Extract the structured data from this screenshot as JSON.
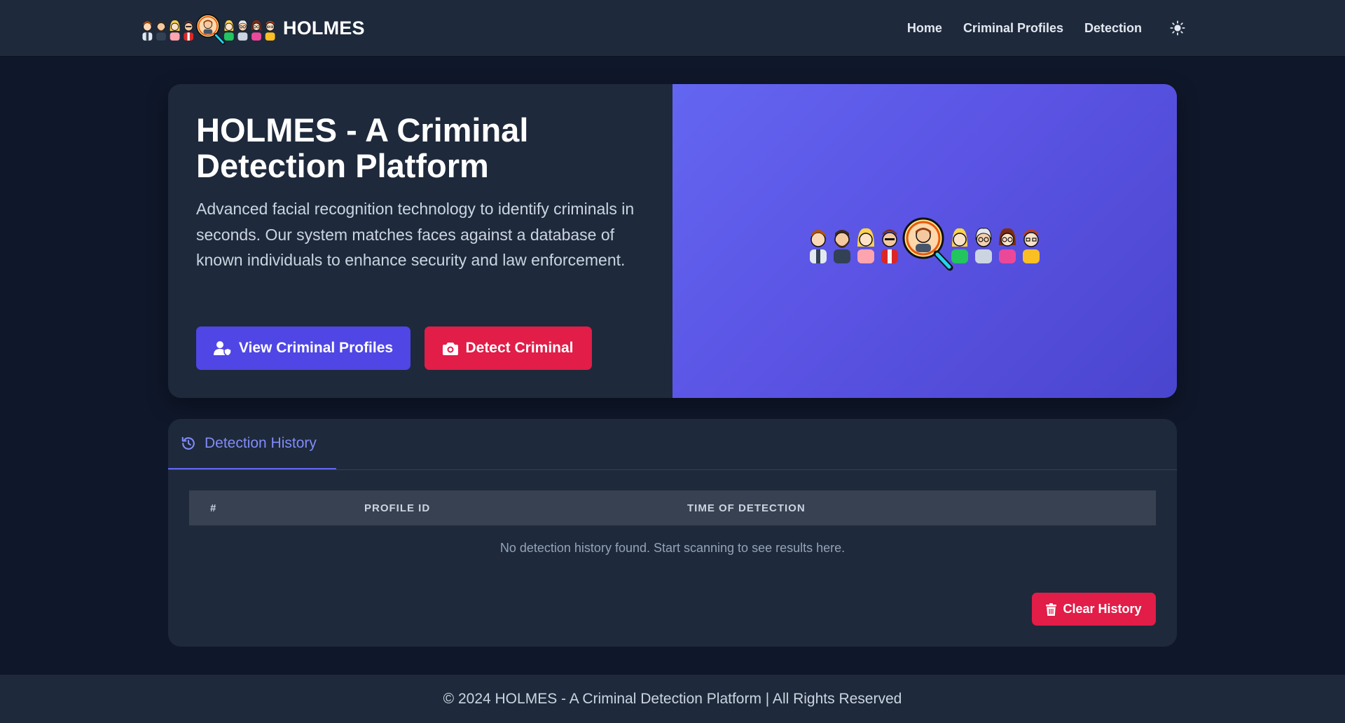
{
  "navbar": {
    "brand_name": "HOLMES",
    "logo_icon": "suspects-lineup-magnifier-icon",
    "links": [
      "Home",
      "Criminal Profiles",
      "Detection"
    ],
    "theme_icon": "sun-icon"
  },
  "hero": {
    "title": "HOLMES - A Criminal Detection Platform",
    "description": "Advanced facial recognition technology to identify criminals in seconds. Our system matches faces against a database of known individuals to enhance security and law enforcement.",
    "primary_button": "View Criminal Profiles",
    "primary_icon": "user-shield-icon",
    "secondary_button": "Detect Criminal",
    "secondary_icon": "camera-icon",
    "illustration": "suspects-lineup-magnifier-icon"
  },
  "history": {
    "tab_label": "Detection History",
    "tab_icon": "history-icon",
    "columns": [
      "#",
      "PROFILE ID",
      "TIME OF DETECTION"
    ],
    "rows": [],
    "empty_message": "No detection history found. Start scanning to see results here.",
    "clear_button": "Clear History",
    "clear_icon": "trash-icon"
  },
  "footer": {
    "text": "© 2024 HOLMES - A Criminal Detection Platform | All Rights Reserved"
  },
  "colors": {
    "background": "#0f172a",
    "surface": "#1e293b",
    "accent": "#4f46e5",
    "danger": "#e11d48",
    "tab_accent": "#818cf8"
  }
}
